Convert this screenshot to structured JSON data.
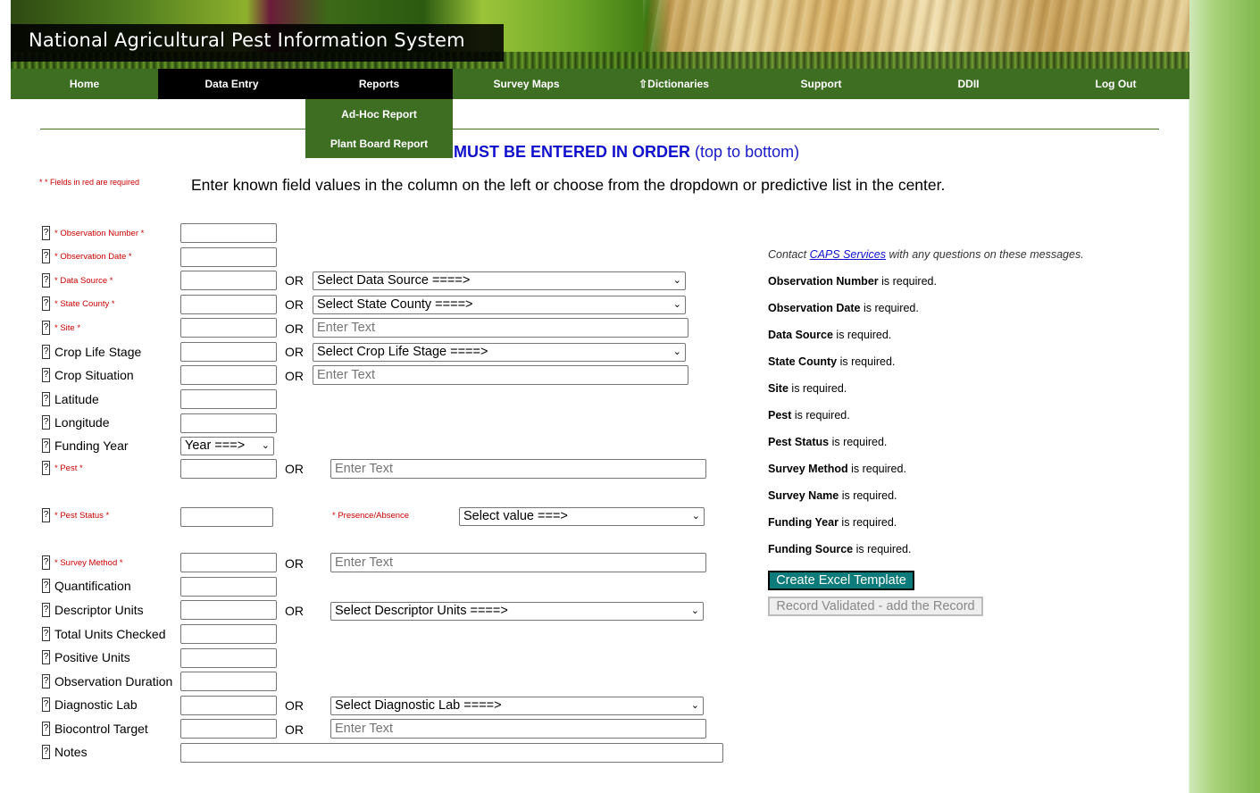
{
  "banner": {
    "title": "National Agricultural Pest Information System"
  },
  "nav": {
    "items": [
      {
        "label": "Home"
      },
      {
        "label": "Data Entry"
      },
      {
        "label": "Reports"
      },
      {
        "label": "Survey Maps"
      },
      {
        "label": "⇧Dictionaries"
      },
      {
        "label": "Support"
      },
      {
        "label": "DDII"
      },
      {
        "label": "Log Out"
      }
    ],
    "reports_menu": [
      "Ad-Hoc Report",
      "Plant Board Report"
    ]
  },
  "order_note": {
    "bold": "MUST BE ENTERED IN ORDER",
    "normal": "(top to bottom)"
  },
  "required_note": "* * Fields in red are required",
  "instructions": "Enter known field values in the column on the left or choose from the dropdown or predictive list in the center.",
  "help_glyph": "?",
  "or_label": "OR",
  "fields": {
    "observation_number": "* Observation Number *",
    "observation_date": "* Observation Date *",
    "data_source": "* Data Source *",
    "state_county": "* State County *",
    "site": "* Site *",
    "crop_life_stage": "Crop Life Stage",
    "crop_situation": "Crop Situation",
    "latitude": "Latitude",
    "longitude": "Longitude",
    "funding_year": "Funding Year",
    "pest": "* Pest *",
    "pest_status": "* Pest Status *",
    "presence_absence": "* Presence/Absence",
    "survey_method": "* Survey Method *",
    "quantification": "Quantification",
    "descriptor_units": "Descriptor Units",
    "total_units_checked": "Total Units Checked",
    "positive_units": "Positive Units",
    "observation_duration": "Observation Duration",
    "diagnostic_lab": "Diagnostic Lab",
    "biocontrol_target": "Biocontrol Target",
    "notes": "Notes"
  },
  "selects": {
    "data_source": "Select Data Source ====>",
    "state_county": "Select State County ====>",
    "crop_life_stage": "Select Crop Life Stage ====>",
    "funding_year": "Year ===>",
    "presence_absence": "Select value ===>",
    "descriptor_units": "Select Descriptor Units ====>",
    "diagnostic_lab": "Select Diagnostic Lab ====>"
  },
  "placeholders": {
    "enter_text": "Enter Text"
  },
  "contact": {
    "prefix": "Contact ",
    "link": "CAPS Services",
    "suffix": " with any questions on these messages."
  },
  "messages": [
    {
      "field": "Observation Number",
      "text": " is required."
    },
    {
      "field": "Observation Date",
      "text": " is required."
    },
    {
      "field": "Data Source",
      "text": " is required."
    },
    {
      "field": "State County",
      "text": " is required."
    },
    {
      "field": "Site",
      "text": " is required."
    },
    {
      "field": "Pest",
      "text": " is required."
    },
    {
      "field": "Pest Status",
      "text": " is required."
    },
    {
      "field": "Survey Method",
      "text": " is required."
    },
    {
      "field": "Survey Name",
      "text": " is required."
    },
    {
      "field": "Funding Year",
      "text": " is required."
    },
    {
      "field": "Funding Source",
      "text": " is required."
    }
  ],
  "buttons": {
    "excel": "Create Excel Template",
    "record": "Record Validated - add the Record"
  },
  "colors": {
    "nav_green": "#3d6e22",
    "required_red": "#cc0000",
    "order_blue": "#1010cc",
    "excel_teal": "#0e7b7b"
  }
}
